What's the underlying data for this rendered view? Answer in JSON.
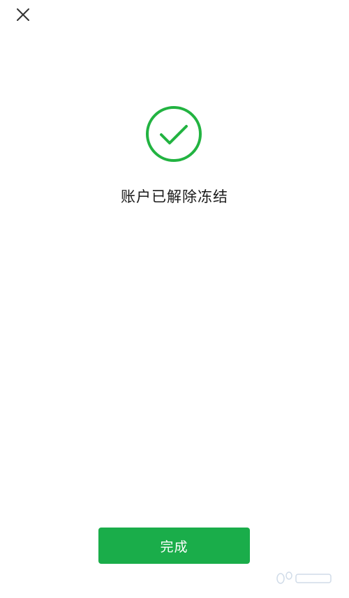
{
  "header": {
    "close_icon": "close-icon"
  },
  "result": {
    "icon": "check-circle-icon",
    "message": "账户已解除冻结"
  },
  "footer": {
    "done_label": "完成"
  },
  "colors": {
    "accent": "#1aad4a",
    "success_icon": "#22b341",
    "close_icon": "#333333",
    "text": "#1a1a1a"
  }
}
